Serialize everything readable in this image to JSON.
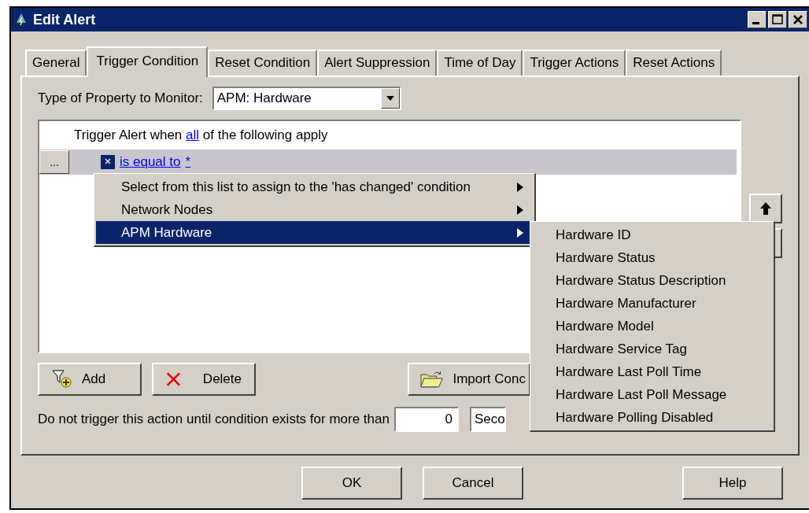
{
  "window": {
    "title": "Edit Alert"
  },
  "tabs": [
    {
      "label": "General",
      "selected": false
    },
    {
      "label": "Trigger Condition",
      "selected": true
    },
    {
      "label": "Reset Condition",
      "selected": false
    },
    {
      "label": "Alert Suppression",
      "selected": false
    },
    {
      "label": "Time of Day",
      "selected": false
    },
    {
      "label": "Trigger Actions",
      "selected": false
    },
    {
      "label": "Reset Actions",
      "selected": false
    }
  ],
  "property": {
    "label": "Type of Property to Monitor:",
    "value": "APM: Hardware"
  },
  "conditions": {
    "header": {
      "before": "Trigger Alert when",
      "link": "all",
      "after": "of the following apply"
    },
    "rows": [
      {
        "menu_button": "...",
        "operator": "is equal to",
        "value": "*"
      }
    ]
  },
  "context_menu": {
    "items": [
      {
        "label": "Select from this list to assign to the 'has changed' condition",
        "has_submenu": true,
        "selected": false
      },
      {
        "label": "Network Nodes",
        "has_submenu": true,
        "selected": false
      },
      {
        "label": "APM Hardware",
        "has_submenu": true,
        "selected": true
      }
    ]
  },
  "submenu": {
    "items": [
      {
        "label": "Hardware ID"
      },
      {
        "label": "Hardware Status"
      },
      {
        "label": "Hardware Status Description"
      },
      {
        "label": "Hardware Manufacturer"
      },
      {
        "label": "Hardware Model"
      },
      {
        "label": "Hardware Service Tag"
      },
      {
        "label": "Hardware Last Poll Time"
      },
      {
        "label": "Hardware Last Poll Message"
      },
      {
        "label": "Hardware Polling Disabled"
      }
    ]
  },
  "buttons": [
    {
      "kind": "add",
      "label": "Add"
    },
    {
      "kind": "delete",
      "label": "Delete"
    },
    {
      "kind": "import",
      "label": "Import Conc"
    }
  ],
  "delay": {
    "label": "Do not trigger this action until condition exists for more than",
    "value": "0",
    "unit": "Seco"
  },
  "footer_buttons": [
    {
      "label": "OK"
    },
    {
      "label": "Cancel"
    },
    {
      "label": "Help"
    }
  ]
}
